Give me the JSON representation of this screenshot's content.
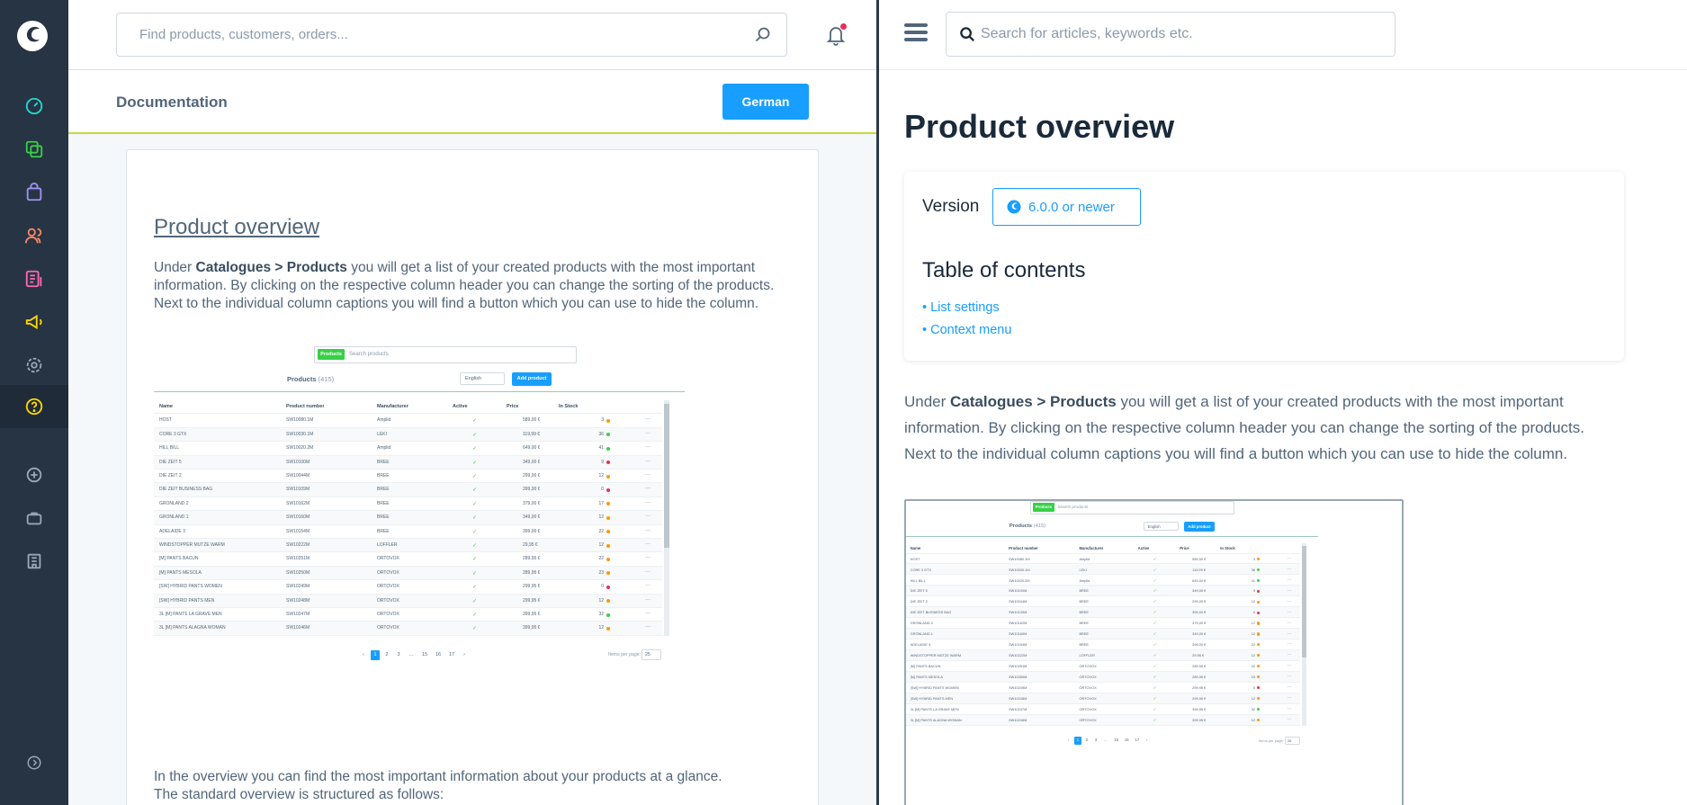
{
  "app": {
    "logo": "shopware-logo"
  },
  "sidebar": {
    "items": [
      {
        "name": "dashboard-icon",
        "color": "#1fdad0"
      },
      {
        "name": "catalogues-icon",
        "color": "#37d046"
      },
      {
        "name": "orders-icon",
        "color": "#a092f0"
      },
      {
        "name": "customers-icon",
        "color": "#f88962"
      },
      {
        "name": "content-icon",
        "color": "#ff68b4"
      },
      {
        "name": "marketing-icon",
        "color": "#ffd700"
      },
      {
        "name": "settings-icon",
        "color": "#9aa8b5"
      },
      {
        "name": "help-icon",
        "color": "#ffd700"
      },
      {
        "name": "add-icon",
        "color": "#9aa8b5"
      },
      {
        "name": "extensions-icon",
        "color": "#9aa8b5"
      },
      {
        "name": "sales-channel-icon",
        "color": "#9aa8b5"
      },
      {
        "name": "collapse-icon",
        "color": "#9aa8b5"
      }
    ]
  },
  "admin": {
    "search_placeholder": "Find products, customers, orders...",
    "header_title": "Documentation",
    "language_button": "German",
    "content": {
      "title": "Product overview",
      "intro": {
        "pre": "Under ",
        "bold": "Catalogues > Products",
        "post": " you will get a list of your created products with the most important information. By clicking on the respective column header you can change the sorting of the products. Next to the individual column captions you will find a button which you can use to hide the column."
      },
      "para2_line1": "In the overview you can find the most important information about your products at a glance.",
      "para2_line2": "The standard overview is structured as follows:"
    }
  },
  "docs": {
    "search_placeholder": "Search for articles, keywords etc.",
    "title": "Product overview",
    "version_label": "Version",
    "version_value": "6.0.0 or newer",
    "toc_title": "Table of contents",
    "toc_items": [
      "List settings",
      "Context menu"
    ],
    "intro": {
      "pre": "Under ",
      "bold": "Catalogues > Products",
      "post": " you will get a list of your created products with the most important information. By clicking on the respective column header you can change the sorting of the products. Next to the individual column captions you will find a button which you can use to hide the column."
    }
  },
  "screenshot": {
    "tag": "Products",
    "search_placeholder": "Search products",
    "title": "Products",
    "count": "(415)",
    "language": "English",
    "add_button": "Add product",
    "headers": [
      "Name",
      "Product number",
      "Manufacturer",
      "Active",
      "Price",
      "In Stock"
    ],
    "rows": [
      [
        "HOST",
        "SW10080.1M",
        "Amplid",
        "✓",
        "589,00 €",
        "3",
        "#ff9800"
      ],
      [
        "CORE 3 GTX",
        "SW10030.1M",
        "LEKI",
        "✓",
        "119,99 €",
        "36",
        "#37d046"
      ],
      [
        "HILL BILL",
        "SW10020.2M",
        "Amplid",
        "✓",
        "649,00 €",
        "41",
        "#37d046"
      ],
      [
        "DIE ZEIT 5",
        "SW10100M",
        "BREE",
        "✓",
        "349,00 €",
        "9",
        "#e52f5a"
      ],
      [
        "DIE ZEIT 2",
        "SW10044M",
        "BREE",
        "✓",
        "299,00 €",
        "12",
        "#ff9800"
      ],
      [
        "DIE ZEIT BUSINESS BAG",
        "SW10109M",
        "BREE",
        "✓",
        "399,00 €",
        "0",
        "#e52f5a"
      ],
      [
        "GRÖNLAND 2",
        "SW10162M",
        "BREE",
        "✓",
        "379,00 €",
        "17",
        "#ff9800"
      ],
      [
        "GRÖNLAND 1",
        "SW10160M",
        "BREE",
        "✓",
        "349,00 €",
        "12",
        "#ff9800"
      ],
      [
        "ADELAIDE 3",
        "SW10154M",
        "BREE",
        "✓",
        "399,00 €",
        "22",
        "#ff9800"
      ],
      [
        "WINDSTOPPER MÜTZE WARM",
        "SW10222M",
        "LÖFFLER",
        "✓",
        "29,95 €",
        "12",
        "#ff9800"
      ],
      [
        "[M] PANTS BACUN",
        "SW10251M",
        "ORTOVOX",
        "✓",
        "289,95 €",
        "22",
        "#ff9800"
      ],
      [
        "[M] PANTS MESOLA",
        "SW10250M",
        "ORTOVOX",
        "✓",
        "289,95 €",
        "23",
        "#ff9800"
      ],
      [
        "[SW] HYBRID PANTS WOMEN",
        "SW10249M",
        "ORTOVOX",
        "✓",
        "299,95 €",
        "0",
        "#e52f5a"
      ],
      [
        "[SW] HYBRID PANTS MEN",
        "SW10248M",
        "ORTOVOX",
        "✓",
        "299,95 €",
        "12",
        "#ff9800"
      ],
      [
        "3L [M] PANTS LA GRAVE MEN",
        "SW10247M",
        "ORTOVOX",
        "✓",
        "399,95 €",
        "32",
        "#37d046"
      ],
      [
        "3L [M] PANTS ALAGNA WOMAN",
        "SW10246M",
        "ORTOVOX",
        "✓",
        "399,95 €",
        "12",
        "#ff9800"
      ]
    ],
    "pagination": [
      "‹",
      "1",
      "2",
      "3",
      "...",
      "15",
      "16",
      "17",
      "›"
    ],
    "items_per_page_label": "Items per page:",
    "items_per_page": "25"
  }
}
